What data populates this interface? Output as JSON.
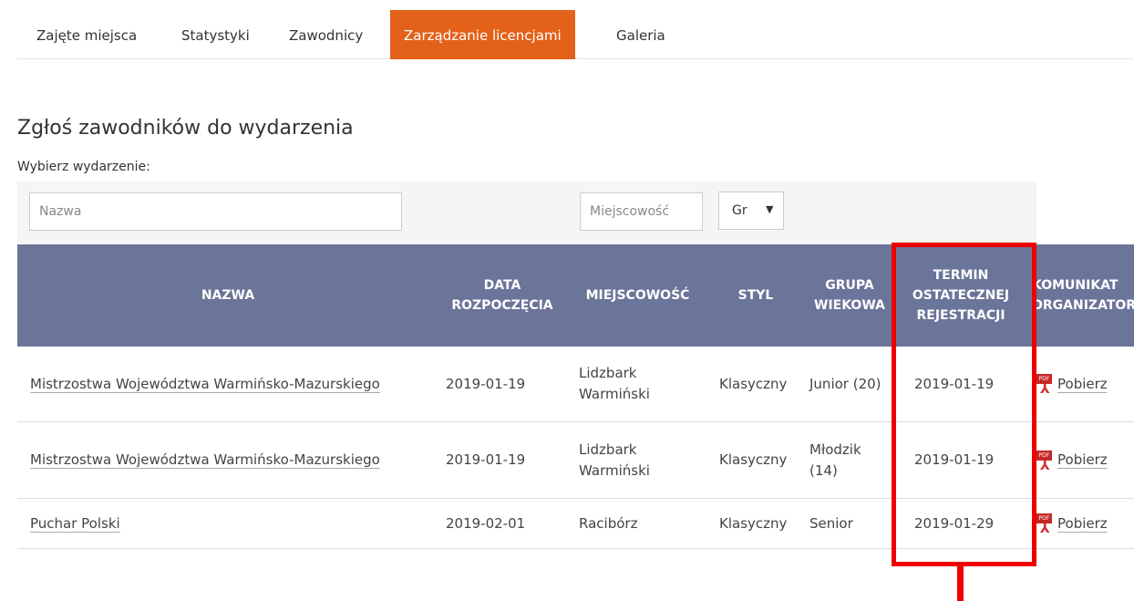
{
  "tabs": [
    {
      "label": "Zajęte miejsca"
    },
    {
      "label": "Statystyki"
    },
    {
      "label": "Zawodnicy"
    },
    {
      "label": "Zarządzanie licencjami",
      "active": true
    },
    {
      "label": "Galeria"
    }
  ],
  "section": {
    "title": "Zgłoś zawodników do wydarzenia",
    "select_label": "Wybierz wydarzenie:"
  },
  "filters": {
    "name_placeholder": "Nazwa",
    "city_placeholder": "Miejscowość",
    "group_value": "Gr"
  },
  "table": {
    "headers": {
      "name": "NAZWA",
      "start": "DATA ROZPOCZĘCIA",
      "city": "MIEJSCOWOŚĆ",
      "style": "STYL",
      "group": "GRUPA WIEKOWA",
      "deadline": "TERMIN OSTATECZNEJ REJESTRACJI",
      "comm": "KOMUNIKAT ORGANIZATORA"
    },
    "rows": [
      {
        "name": "Mistrzostwa Województwa Warmińsko-Mazurskiego",
        "start": "2019-01-19",
        "city": "Lidzbark Warmiński",
        "style": "Klasyczny",
        "group": "Junior (20)",
        "deadline": "2019-01-19",
        "comm": "Pobierz"
      },
      {
        "name": "Mistrzostwa Województwa Warmińsko-Mazurskiego",
        "start": "2019-01-19",
        "city": "Lidzbark Warmiński",
        "style": "Klasyczny",
        "group": "Młodzik (14)",
        "deadline": "2019-01-19",
        "comm": "Pobierz"
      },
      {
        "name": "Puchar Polski",
        "start": "2019-02-01",
        "city": "Racibórz",
        "style": "Klasyczny",
        "group": "Senior",
        "deadline": "2019-01-29",
        "comm": "Pobierz"
      }
    ]
  },
  "colors": {
    "accent": "#e4611a",
    "table_header": "#6b7499",
    "highlight": "#ee0000"
  },
  "icons": {
    "pdf": "pdf-icon"
  }
}
